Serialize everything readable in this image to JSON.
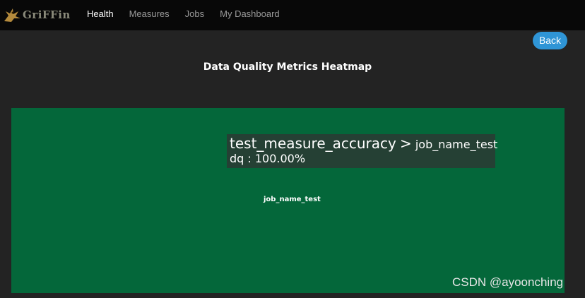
{
  "nav": {
    "logo_text": "GriFFin",
    "items": [
      {
        "label": "Health",
        "active": true
      },
      {
        "label": "Measures",
        "active": false
      },
      {
        "label": "Jobs",
        "active": false
      },
      {
        "label": "My Dashboard",
        "active": false
      }
    ]
  },
  "back_label": "Back",
  "page_title": "Data Quality Metrics Heatmap",
  "heatmap": {
    "cell_label": "job_name_test",
    "cell_color": "#04673a",
    "tooltip": {
      "measure": "test_measure_accuracy",
      "separator": ">",
      "job": "job_name_test",
      "dq_text": "dq : 100.00%"
    }
  },
  "watermark": "CSDN @ayoonching",
  "colors": {
    "background": "#232323",
    "navbar": "#080808",
    "accent": "#2f95d6"
  }
}
